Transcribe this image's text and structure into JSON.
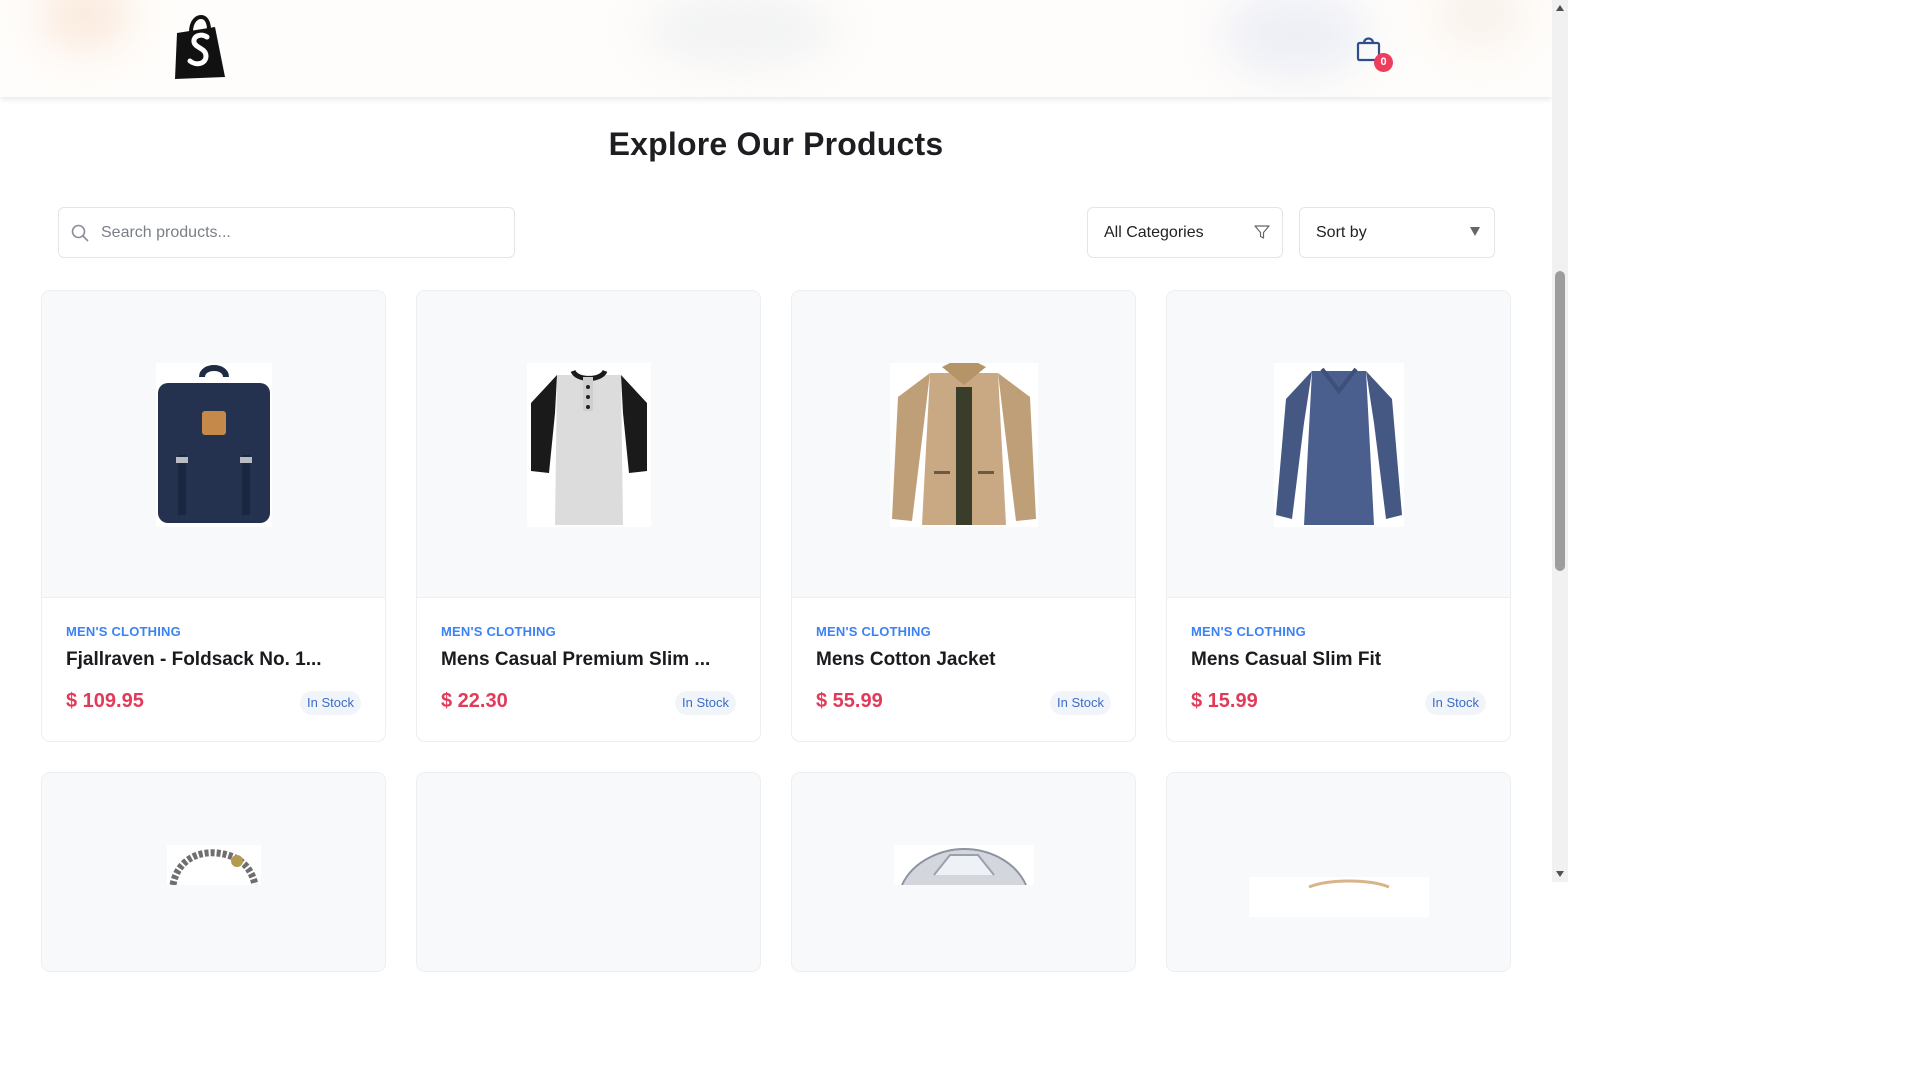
{
  "header": {
    "logo_icon": "shopify-bag-logo",
    "cart_icon": "shopping-bag-icon",
    "cart_count": "0"
  },
  "page": {
    "title": "Explore Our Products"
  },
  "filters": {
    "search_placeholder": "Search products...",
    "search_value": "",
    "category_label": "All Categories",
    "category_icon": "filter-icon",
    "sort_label": "Sort by",
    "sort_icon": "caret-down-icon"
  },
  "products": [
    {
      "category": "MEN'S CLOTHING",
      "name": "Fjallraven - Foldsack No. 1...",
      "price": "$ 109.95",
      "stock": "In Stock",
      "image": "backpack"
    },
    {
      "category": "MEN'S CLOTHING",
      "name": "Mens Casual Premium Slim ...",
      "price": "$ 22.30",
      "stock": "In Stock",
      "image": "raglan-tshirt"
    },
    {
      "category": "MEN'S CLOTHING",
      "name": "Mens Cotton Jacket",
      "price": "$ 55.99",
      "stock": "In Stock",
      "image": "cotton-jacket"
    },
    {
      "category": "MEN'S CLOTHING",
      "name": "Mens Casual Slim Fit",
      "price": "$ 15.99",
      "stock": "In Stock",
      "image": "long-sleeve-tee"
    }
  ],
  "products_row2": [
    {
      "image": "chain-bracelet"
    },
    {
      "image": "blank"
    },
    {
      "image": "diamond-ring"
    },
    {
      "image": "gold-ring"
    }
  ],
  "colors": {
    "accent_blue": "#3b82f6",
    "price_red": "#e23b5a",
    "badge_red": "#ee3d5d"
  }
}
